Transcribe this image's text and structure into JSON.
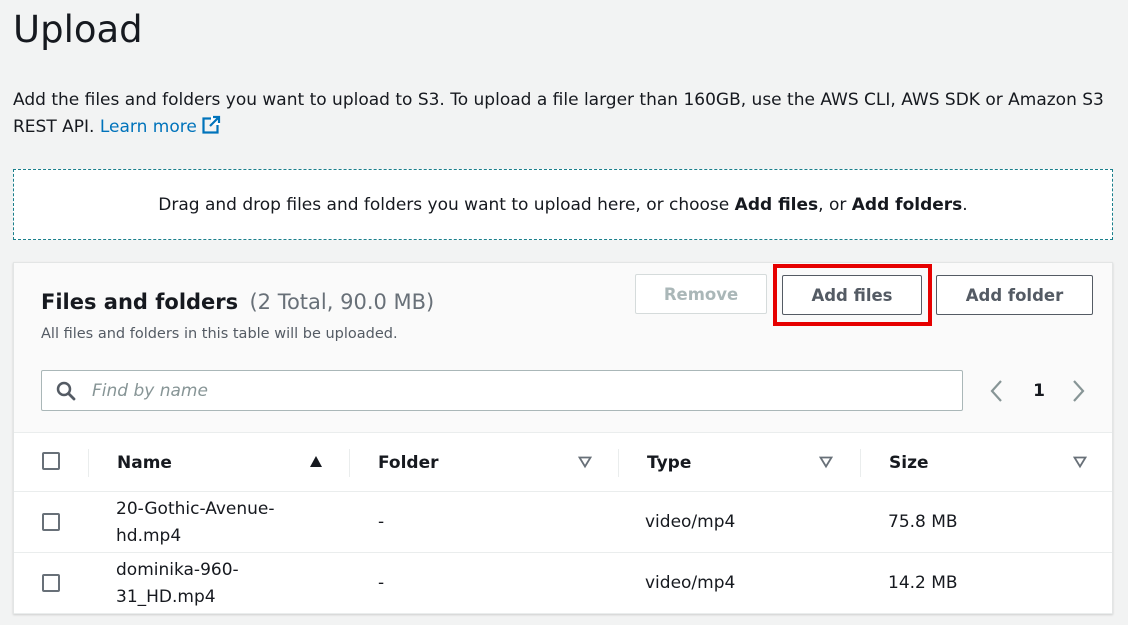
{
  "page": {
    "title": "Upload",
    "intro_text": "Add the files and folders you want to upload to S3. To upload a file larger than 160GB, use the AWS CLI, AWS SDK or Amazon S3 REST API.",
    "learn_more": "Learn more",
    "external_icon": "external-link-icon"
  },
  "dropzone": {
    "text_before": "Drag and drop files and folders you want to upload here, or choose ",
    "add_files": "Add files",
    "text_middle": ", or ",
    "add_folders": "Add folders",
    "text_after": "."
  },
  "panel": {
    "title": "Files and folders",
    "count": "(2 Total, 90.0 MB)",
    "description": "All files and folders in this table will be uploaded.",
    "buttons": {
      "remove": "Remove",
      "add_files": "Add files",
      "add_folder": "Add folder"
    },
    "highlight_color": "#e60000"
  },
  "search": {
    "placeholder": "Find by name",
    "value": "",
    "icon": "search-icon"
  },
  "pagination": {
    "current_page": "1"
  },
  "table": {
    "columns": [
      {
        "label": "Name",
        "sort": "ascending"
      },
      {
        "label": "Folder",
        "sort": "none"
      },
      {
        "label": "Type",
        "sort": "none"
      },
      {
        "label": "Size",
        "sort": "none"
      }
    ],
    "rows": [
      {
        "name": "20-Gothic-Avenue-hd.mp4",
        "folder": "-",
        "type": "video/mp4",
        "size": "75.8 MB"
      },
      {
        "name": "dominika-960-31_HD.mp4",
        "folder": "-",
        "type": "video/mp4",
        "size": "14.2 MB"
      }
    ]
  },
  "colors": {
    "link": "#0073bb",
    "dropzone_border": "#1a7f8b",
    "text": "#16191f",
    "secondary_text": "#545b64"
  }
}
